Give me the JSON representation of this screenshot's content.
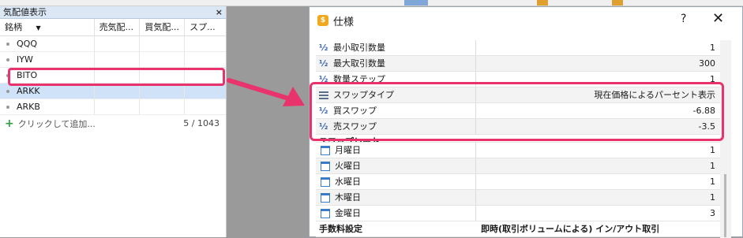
{
  "toolbar": {
    "colors": {
      "button": "#7fa8d8",
      "accent": "#e0a030"
    }
  },
  "market_watch": {
    "title": "気配値表示",
    "close_label": "×",
    "columns": [
      "銘柄",
      "売気配...",
      "買気配...",
      "スプ..."
    ],
    "sort_icon": "▼",
    "rows": [
      {
        "symbol": "QQQ"
      },
      {
        "symbol": "IYW"
      },
      {
        "symbol": "BITO"
      },
      {
        "symbol": "ARKK"
      },
      {
        "symbol": "ARKB"
      }
    ],
    "add_label": "クリックして追加...",
    "count": "5 / 1043"
  },
  "dialog": {
    "icon_label": "$",
    "title": "仕様",
    "help_label": "?",
    "close_label": "✕",
    "properties": [
      {
        "name": "最小取引数量",
        "value": "1"
      },
      {
        "name": "最大取引数量",
        "value": "300"
      },
      {
        "name": "数量ステップ",
        "value": "1"
      },
      {
        "name": "スワップタイプ",
        "value": "現在価格によるパーセント表示"
      },
      {
        "name": "買スワップ",
        "value": "-6.88"
      },
      {
        "name": "売スワップ",
        "value": "-3.5"
      }
    ],
    "swap_group": "スワップレート",
    "days": [
      {
        "name": "月曜日",
        "value": "1"
      },
      {
        "name": "火曜日",
        "value": "1"
      },
      {
        "name": "水曜日",
        "value": "1"
      },
      {
        "name": "木曜日",
        "value": "1"
      },
      {
        "name": "金曜日",
        "value": "3"
      }
    ],
    "fee_group": "手数料設定",
    "fee_value": "即時(取引ボリュームによる) イン/アウト取引"
  },
  "highlight_color": "#e8336c"
}
